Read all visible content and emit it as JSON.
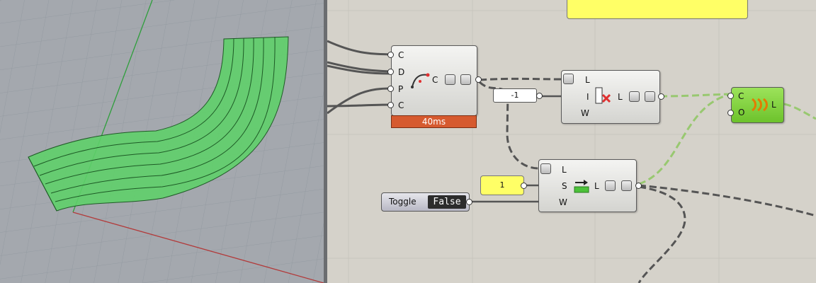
{
  "viewport": {
    "name": "rhino-perspective-viewport"
  },
  "canvas": {
    "curve_component": {
      "inputs": [
        "C",
        "D",
        "P",
        "C"
      ],
      "output": "C",
      "timer": "40ms"
    },
    "list_item_component": {
      "inputs": [
        "L",
        "I",
        "W"
      ],
      "output": "L"
    },
    "shift_list_component": {
      "inputs": [
        "L",
        "S",
        "W"
      ],
      "output": "L"
    },
    "weave_component": {
      "inputs": [
        "C",
        "O"
      ],
      "output": "L",
      "color": "#7fd33a"
    },
    "panel_minus_one": {
      "value": "-1"
    },
    "panel_one": {
      "value": "1"
    },
    "toggle": {
      "label": "Toggle",
      "value": "False"
    }
  }
}
